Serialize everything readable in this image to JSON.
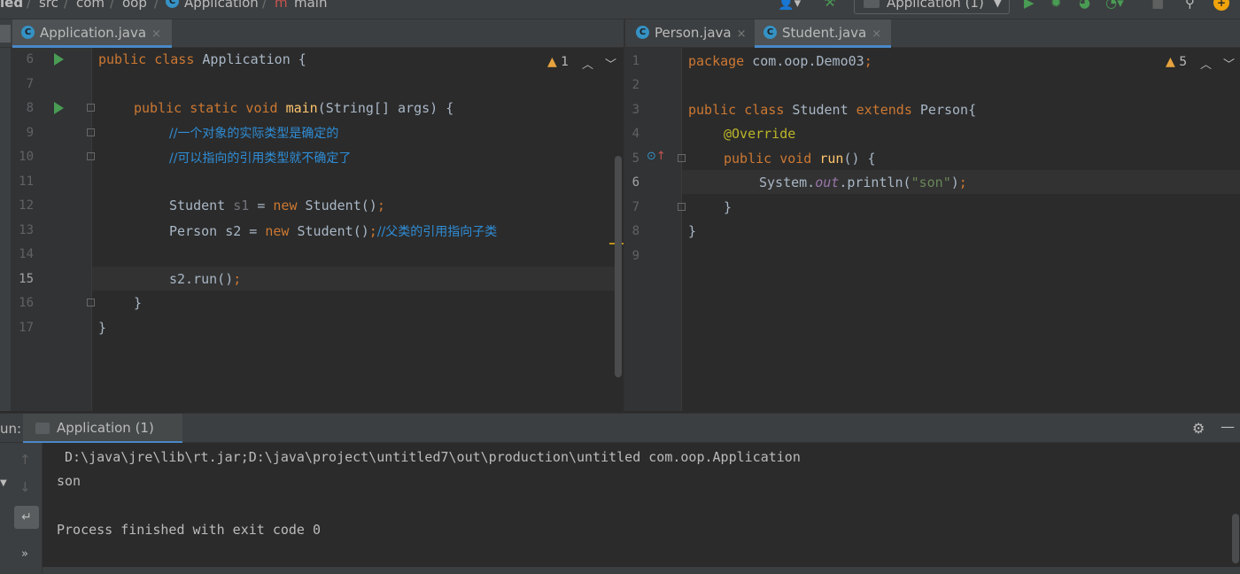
{
  "breadcrumb": {
    "items": [
      "led",
      "src",
      "com",
      "oop",
      "Application",
      "main"
    ],
    "separator": "/"
  },
  "toolbar": {
    "run_config": "Application (1)"
  },
  "editor_left": {
    "tab": {
      "label": "Application.java",
      "close": "×"
    },
    "warning_count": "1",
    "warning_symbol": "▲",
    "lines": [
      {
        "n": "6"
      },
      {
        "n": "7"
      },
      {
        "n": "8"
      },
      {
        "n": "9"
      },
      {
        "n": "10"
      },
      {
        "n": "11"
      },
      {
        "n": "12"
      },
      {
        "n": "13"
      },
      {
        "n": "14"
      },
      {
        "n": "15"
      },
      {
        "n": "16"
      },
      {
        "n": "17"
      }
    ],
    "code": {
      "l6_kw": "public class",
      "l6_rest": " Application {",
      "l8_kw": "public static void",
      "l8_fn": "main",
      "l8_rest": "(String[] args) {",
      "l9_comment": "//一个对象的实际类型是确定的",
      "l10_comment": "//可以指向的引用类型就不确定了",
      "l12_a": "Student ",
      "l12_var": "s1",
      "l12_b": " = ",
      "l12_kw": "new",
      "l12_c": " Student()",
      "l12_semi": ";",
      "l13_a": "Person s2 = ",
      "l13_kw": "new",
      "l13_c": " Student()",
      "l13_semi": ";",
      "l13_comment": "//父类的引用指向子类",
      "l15_a": "s2.run()",
      "l15_semi": ";",
      "l16": "}",
      "l17": "}"
    }
  },
  "editor_right": {
    "tabs": [
      {
        "label": "Person.java",
        "close": "×"
      },
      {
        "label": "Student.java",
        "close": "×"
      }
    ],
    "warning_count": "5",
    "warning_symbol": "▲",
    "lines": [
      {
        "n": "1"
      },
      {
        "n": "2"
      },
      {
        "n": "3"
      },
      {
        "n": "4"
      },
      {
        "n": "5"
      },
      {
        "n": "6"
      },
      {
        "n": "7"
      },
      {
        "n": "8"
      },
      {
        "n": "9"
      }
    ],
    "code": {
      "l1_kw": "package",
      "l1_rest": " com.oop.Demo03",
      "l1_semi": ";",
      "l3_kw": "public class",
      "l3_a": " Student ",
      "l3_kw2": "extends",
      "l3_b": " Person{",
      "l4_ann": "@Override",
      "l5_kw": "public void",
      "l5_fn": "run",
      "l5_rest": "() {",
      "l6_a": "System.",
      "l6_it": "out",
      "l6_b": ".println(",
      "l6_str": "\"son\"",
      "l6_c": ")",
      "l6_semi": ";",
      "l7": "}",
      "l8": "}"
    }
  },
  "run_panel": {
    "label": "un:",
    "tab_label": "Application (1)",
    "console": [
      " D:\\java\\jre\\lib\\rt.jar;D:\\java\\project\\untitled7\\out\\production\\untitled com.oop.Application",
      "son",
      "",
      "Process finished with exit code 0"
    ]
  },
  "colors": {
    "background": "#2b2b2b",
    "panel": "#3c3f41",
    "accent": "#4a88c7",
    "keyword": "#cc7832",
    "function": "#ffc66d",
    "comment": "#2f8dd6",
    "string": "#6a8759",
    "annotation": "#bbb529",
    "run_green": "#499c54"
  }
}
